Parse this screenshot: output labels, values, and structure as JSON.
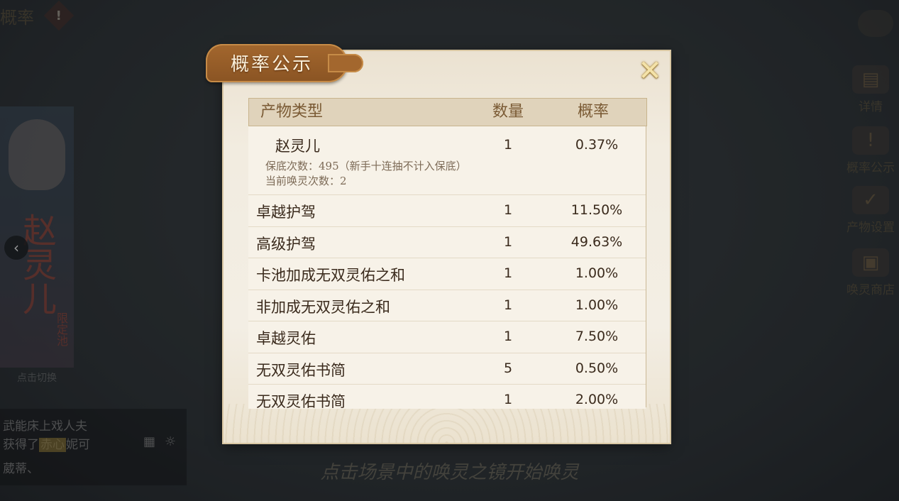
{
  "hud": {
    "top_left_text": "概率",
    "warning_icon": "exclamation-icon",
    "warning_glyph": "!"
  },
  "banner": {
    "character_name": "赵灵儿",
    "tag": "限定池",
    "caption": "点击切换"
  },
  "chat": {
    "line1": "武能床上戏人夫",
    "line2_prefix": "获得了",
    "line2_highlight": "赤心",
    "line2_suffix": "妮可",
    "line3": "葳蒂、"
  },
  "side_menu": [
    {
      "label": "详情",
      "icon": "book-icon",
      "glyph": "▤"
    },
    {
      "label": "概率公示",
      "icon": "exclamation-icon",
      "glyph": "!"
    },
    {
      "label": "产物设置",
      "icon": "check-icon",
      "glyph": "✓"
    },
    {
      "label": "唤灵商店",
      "icon": "gift-icon",
      "glyph": "▣"
    }
  ],
  "hint": "点击场景中的唤灵之镜开始唤灵",
  "dialog": {
    "title": "概率公示",
    "close_glyph": "✕",
    "headers": {
      "type": "产物类型",
      "qty": "数量",
      "prob": "概率"
    },
    "featured": {
      "name": "赵灵儿",
      "qty": "1",
      "prob": "0.37%",
      "pity": "保底次数：495（新手十连抽不计入保底）",
      "current": "当前唤灵次数：2"
    },
    "rows": [
      {
        "name": "卓越护驾",
        "qty": "1",
        "prob": "11.50%"
      },
      {
        "name": "高级护驾",
        "qty": "1",
        "prob": "49.63%"
      },
      {
        "name": "卡池加成无双灵佑之和",
        "qty": "1",
        "prob": "1.00%"
      },
      {
        "name": "非加成无双灵佑之和",
        "qty": "1",
        "prob": "1.00%"
      },
      {
        "name": "卓越灵佑",
        "qty": "1",
        "prob": "7.50%"
      },
      {
        "name": "无双灵佑书简",
        "qty": "5",
        "prob": "0.50%"
      },
      {
        "name": "无双灵佑书简",
        "qty": "1",
        "prob": "2.00%"
      }
    ]
  }
}
